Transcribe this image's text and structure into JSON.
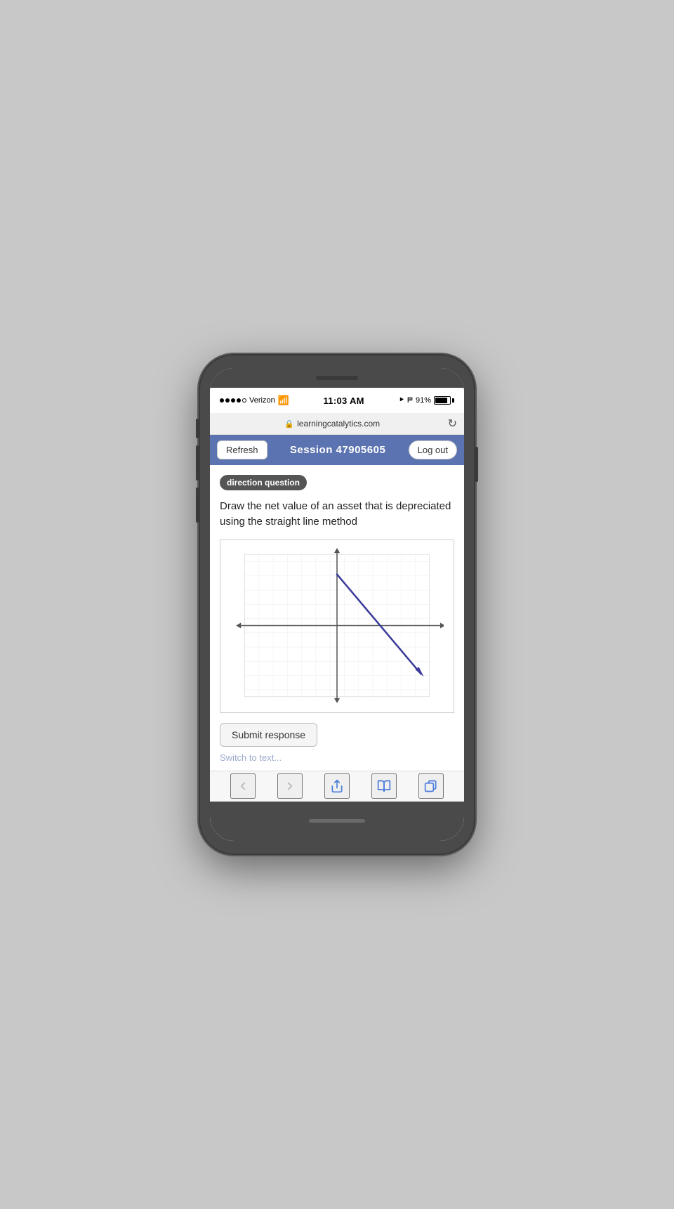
{
  "status_bar": {
    "carrier": "Verizon",
    "time": "11:03 AM",
    "battery_percent": "91%",
    "signal_bars": 4,
    "wifi": true
  },
  "address_bar": {
    "url": "learningcatalytics.com",
    "lock": "🔒",
    "refresh": "↻"
  },
  "app_header": {
    "refresh_label": "Refresh",
    "session_label": "Session 47905605",
    "logout_label": "Log out"
  },
  "question": {
    "tag": "direction question",
    "text": "Draw the net value of an asset that is depreciated using the straight line method"
  },
  "submit": {
    "label": "Submit response"
  },
  "partial_bottom": {
    "text": "Switch to text..."
  },
  "browser_toolbar": {
    "back_label": "‹",
    "forward_label": "›",
    "share_label": "share",
    "bookmarks_label": "book",
    "tabs_label": "tabs"
  }
}
